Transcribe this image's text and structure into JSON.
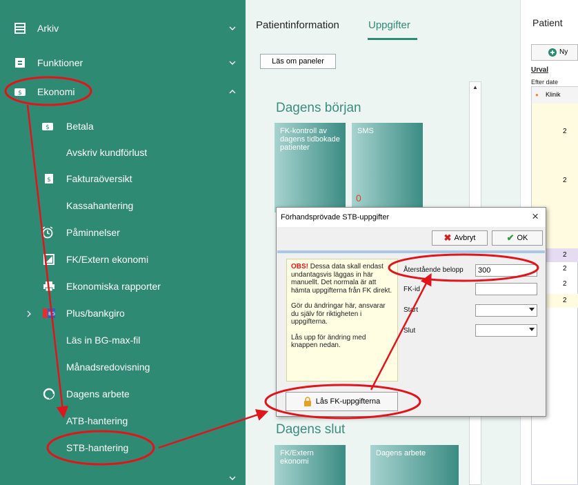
{
  "sidebar": {
    "items": [
      {
        "label": "Arkiv",
        "icon": "archive-icon",
        "chevron": "chevron-down-icon"
      },
      {
        "label": "Funktioner",
        "icon": "functions-icon",
        "chevron": "chevron-down-icon"
      },
      {
        "label": "Ekonomi",
        "icon": "money-icon",
        "chevron": "chevron-up-icon"
      }
    ],
    "subitems": [
      {
        "label": "Betala",
        "icon": "money-icon"
      },
      {
        "label": "Avskriv kundförlust",
        "icon": ""
      },
      {
        "label": "Fakturaöversikt",
        "icon": "invoice-icon"
      },
      {
        "label": "Kassahantering",
        "icon": ""
      },
      {
        "label": "Påminnelser",
        "icon": "alarm-clock-icon"
      },
      {
        "label": "FK/Extern ekonomi",
        "icon": "export-icon"
      },
      {
        "label": "Ekonomiska rapporter",
        "icon": "printer-icon"
      },
      {
        "label": "Plus/bankgiro",
        "icon": "bankgiro-icon"
      },
      {
        "label": "Läs in BG-max-fil",
        "icon": ""
      },
      {
        "label": "Månadsredovisning",
        "icon": ""
      },
      {
        "label": "Dagens arbete",
        "icon": "pie-chart-icon"
      },
      {
        "label": "ATB-hantering",
        "icon": ""
      },
      {
        "label": "STB-hantering",
        "icon": ""
      }
    ]
  },
  "panel": {
    "tabs": [
      "Patientinformation",
      "Uppgifter"
    ],
    "reload_button": "Läs om paneler",
    "section_start": "Dagens början",
    "section_end": "Dagens slut",
    "tiles_top": [
      {
        "label": "FK-kontroll av dagens tidbokade patienter",
        "value": ""
      },
      {
        "label": "SMS",
        "value": "0"
      }
    ],
    "tiles_bottom": [
      {
        "label": "FK/Extern ekonomi"
      },
      {
        "label": "Dagens arbete"
      }
    ]
  },
  "right_panel": {
    "title": "Patient",
    "new_button": "Ny",
    "urval_label": "Urval",
    "efter_date_label": "Efter date",
    "column_header": "Klinik",
    "row_values": [
      "2",
      "2",
      "2",
      "2",
      "2",
      "2"
    ]
  },
  "dialog": {
    "title": "Förhandsprövade STB-uppgifter",
    "close": "×",
    "cancel_button": "Avbryt",
    "ok_button": "OK",
    "note_obs": "OBS!",
    "note_p1": " Dessa data skall endast undantagsvis läggas in här manuellt. Det normala är att hämta uppgifterna från FK direkt.",
    "note_p2": "Gör du ändringar här, ansvarar du själv för riktigheten i uppgifterna.",
    "note_p3": "Lås upp för ändring med knappen nedan.",
    "fields": {
      "remaining_amount_label": "Återstående belopp",
      "remaining_amount_value": "300",
      "fk_id_label": "FK-id",
      "fk_id_value": "",
      "start_label": "Start",
      "start_value": "",
      "end_label": "Slut",
      "end_value": ""
    },
    "lock_button": "Lås FK-uppgifterna"
  },
  "colors": {
    "sidebar": "#2e8a72",
    "accent": "#2e8a72",
    "annotation": "#e0151b",
    "tile_value": "#e0421b"
  }
}
